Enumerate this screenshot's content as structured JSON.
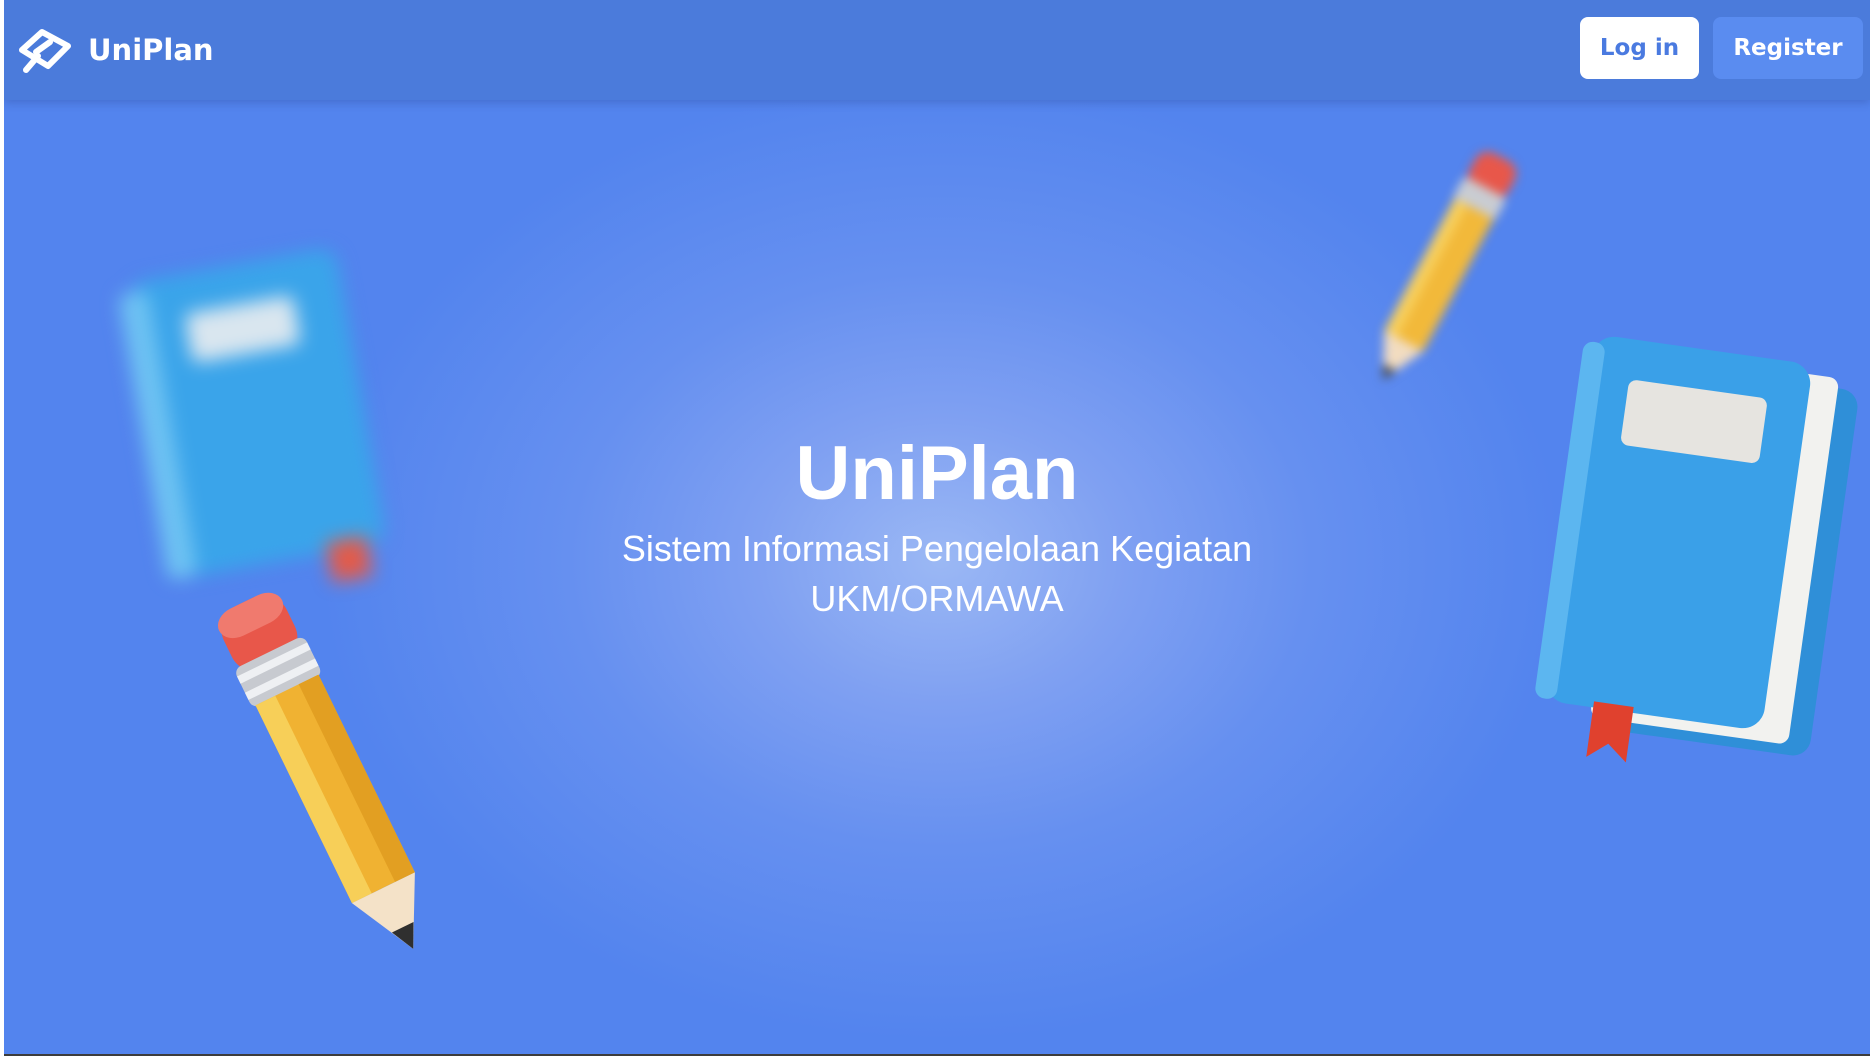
{
  "navbar": {
    "brand_name": "UniPlan",
    "logo_icon": "uniplan-logo-icon",
    "login_label": "Log in",
    "register_label": "Register"
  },
  "hero": {
    "title": "UniPlan",
    "subtitle_line1": "Sistem Informasi Pengelolaan Kegiatan",
    "subtitle_line2": "UKM/ORMAWA"
  },
  "illustrations": [
    "book-illustration",
    "pencil-illustration"
  ],
  "colors": {
    "navbar_bg": "#4b7bdb",
    "hero_bg": "#5384ee",
    "hero_center_glow": "#9bb8f4",
    "login_text": "#4a7ae0",
    "register_bg": "#5a8cf0",
    "book_blue": "#3aa0e8",
    "pencil_yellow": "#f2b93a",
    "eraser_red": "#e8574a"
  }
}
